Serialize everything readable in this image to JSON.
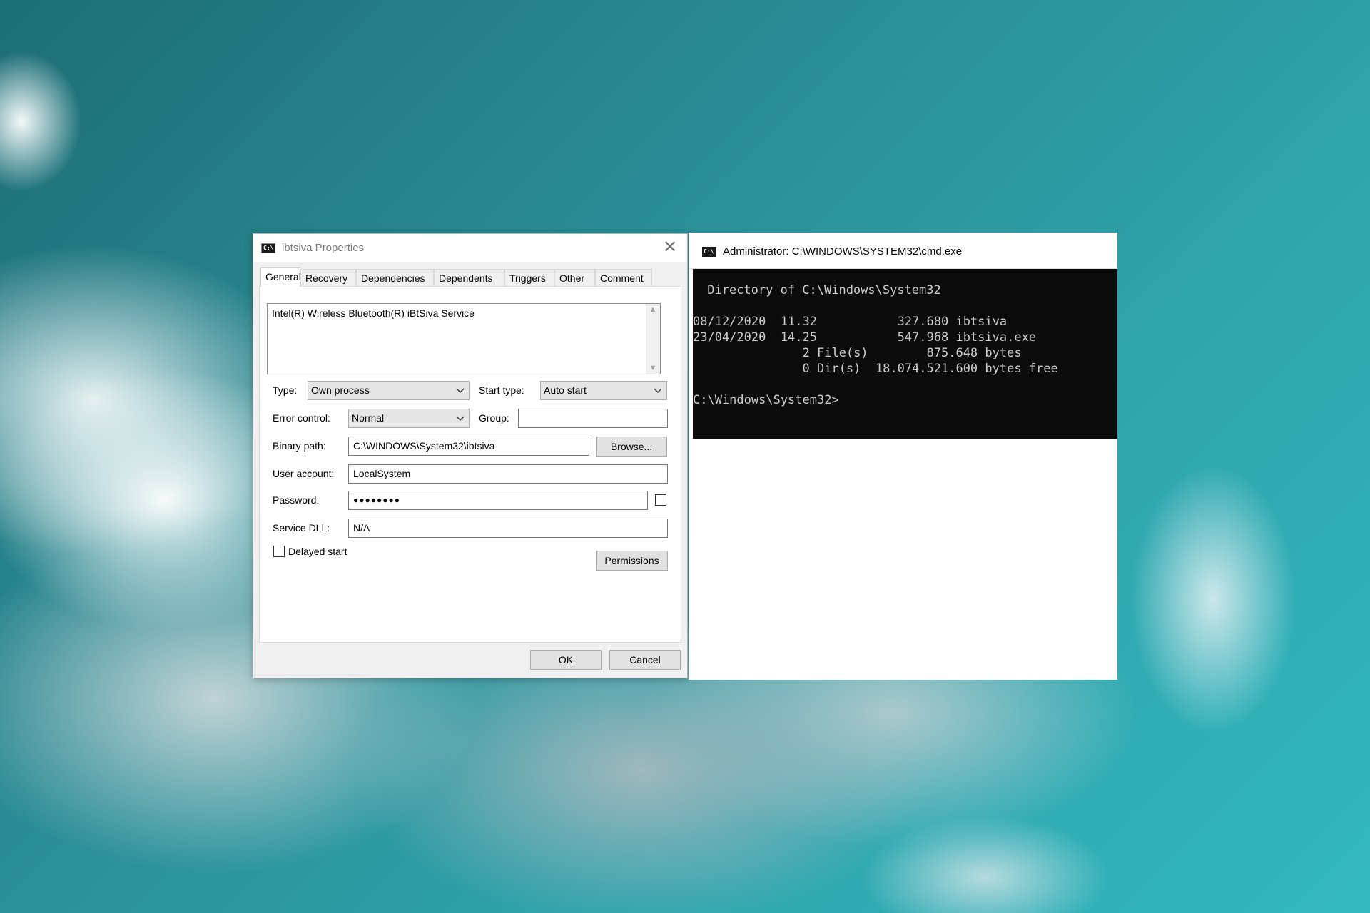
{
  "dialog": {
    "title": "ibtsiva Properties",
    "close_glyph": "✕",
    "tabs": [
      "General",
      "Recovery",
      "Dependencies",
      "Dependents",
      "Triggers",
      "Other",
      "Comment"
    ],
    "description": "Intel(R) Wireless Bluetooth(R) iBtSiva Service",
    "type_label": "Type:",
    "type_value": "Own process",
    "start_type_label": "Start type:",
    "start_type_value": "Auto start",
    "error_control_label": "Error control:",
    "error_control_value": "Normal",
    "group_label": "Group:",
    "group_value": "",
    "binary_path_label": "Binary path:",
    "binary_path_value": "C:\\WINDOWS\\System32\\ibtsiva",
    "browse_label": "Browse...",
    "user_account_label": "User account:",
    "user_account_value": "LocalSystem",
    "password_label": "Password:",
    "password_value": "●●●●●●●●",
    "service_dll_label": "Service DLL:",
    "service_dll_value": "N/A",
    "delayed_start_label": "Delayed start",
    "permissions_label": "Permissions",
    "ok_label": "OK",
    "cancel_label": "Cancel"
  },
  "cmd": {
    "title": "Administrator: C:\\WINDOWS\\SYSTEM32\\cmd.exe",
    "lines": [
      " Directory of C:\\Windows\\System32",
      "",
      "08/12/2020  11.32           327.680 ibtsiva",
      "23/04/2020  14.25           547.968 ibtsiva.exe",
      "               2 File(s)        875.648 bytes",
      "               0 Dir(s)  18.074.521.600 bytes free",
      "",
      "C:\\Windows\\System32>"
    ]
  }
}
